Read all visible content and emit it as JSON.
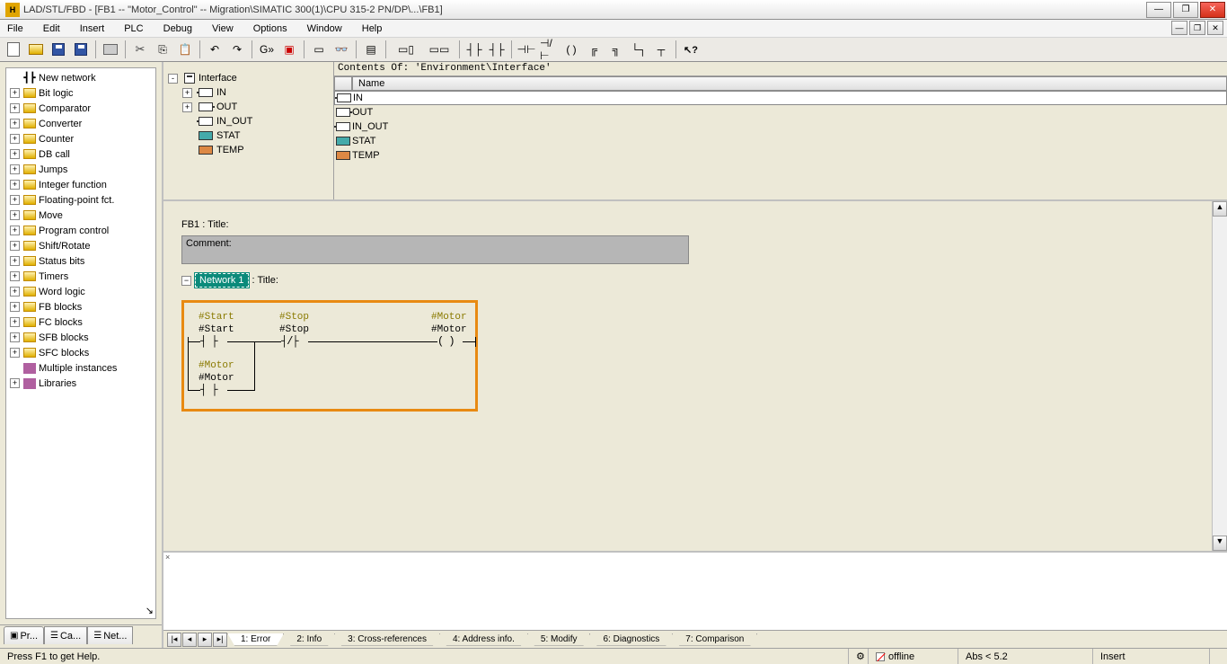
{
  "titlebar": {
    "text": "LAD/STL/FBD  - [FB1 -- \"Motor_Control\" -- Migration\\SIMATIC 300(1)\\CPU 315-2 PN/DP\\...\\FB1]"
  },
  "menu": {
    "items": [
      "File",
      "Edit",
      "Insert",
      "PLC",
      "Debug",
      "View",
      "Options",
      "Window",
      "Help"
    ]
  },
  "sidebar": {
    "items": [
      {
        "label": "New network",
        "expandable": false,
        "icon": "network"
      },
      {
        "label": "Bit logic",
        "expandable": true,
        "icon": "folder"
      },
      {
        "label": "Comparator",
        "expandable": true,
        "icon": "folder"
      },
      {
        "label": "Converter",
        "expandable": true,
        "icon": "folder"
      },
      {
        "label": "Counter",
        "expandable": true,
        "icon": "folder"
      },
      {
        "label": "DB call",
        "expandable": true,
        "icon": "folder"
      },
      {
        "label": "Jumps",
        "expandable": true,
        "icon": "folder"
      },
      {
        "label": "Integer function",
        "expandable": true,
        "icon": "folder"
      },
      {
        "label": "Floating-point fct.",
        "expandable": true,
        "icon": "folder"
      },
      {
        "label": "Move",
        "expandable": true,
        "icon": "folder"
      },
      {
        "label": "Program control",
        "expandable": true,
        "icon": "folder"
      },
      {
        "label": "Shift/Rotate",
        "expandable": true,
        "icon": "folder"
      },
      {
        "label": "Status bits",
        "expandable": true,
        "icon": "folder"
      },
      {
        "label": "Timers",
        "expandable": true,
        "icon": "folder"
      },
      {
        "label": "Word logic",
        "expandable": true,
        "icon": "folder"
      },
      {
        "label": "FB blocks",
        "expandable": true,
        "icon": "folder"
      },
      {
        "label": "FC blocks",
        "expandable": true,
        "icon": "folder"
      },
      {
        "label": "SFB blocks",
        "expandable": true,
        "icon": "folder"
      },
      {
        "label": "SFC blocks",
        "expandable": true,
        "icon": "folder"
      },
      {
        "label": "Multiple instances",
        "expandable": false,
        "icon": "books"
      },
      {
        "label": "Libraries",
        "expandable": true,
        "icon": "books"
      }
    ],
    "tabs": [
      "Pr...",
      "Ca...",
      "Net..."
    ]
  },
  "interface": {
    "contents_label": "Contents Of: 'Environment\\Interface'",
    "tree": [
      {
        "label": "Interface",
        "level": 0,
        "exp": "-",
        "icon": "intf"
      },
      {
        "label": "IN",
        "level": 1,
        "exp": "+",
        "icon": "in"
      },
      {
        "label": "OUT",
        "level": 1,
        "exp": "+",
        "icon": "out"
      },
      {
        "label": "IN_OUT",
        "level": 1,
        "exp": "",
        "icon": "inout"
      },
      {
        "label": "STAT",
        "level": 1,
        "exp": "",
        "icon": "stat"
      },
      {
        "label": "TEMP",
        "level": 1,
        "exp": "",
        "icon": "temp"
      }
    ],
    "columns": {
      "name": "Name"
    },
    "rows": [
      {
        "name": "IN",
        "icon": "in",
        "selected": true
      },
      {
        "name": "OUT",
        "icon": "out"
      },
      {
        "name": "IN_OUT",
        "icon": "inout"
      },
      {
        "name": "STAT",
        "icon": "stat"
      },
      {
        "name": "TEMP",
        "icon": "temp"
      }
    ]
  },
  "editor": {
    "fb_title": "FB1 : Title:",
    "comment_label": "Comment:",
    "network_label": "Network 1",
    "network_title_suffix": ": Title:",
    "symbols": {
      "start_tag": "#Start",
      "start_lbl": "#Start",
      "stop_tag": "#Stop",
      "stop_lbl": "#Stop",
      "motor_tag": "#Motor",
      "motor_lbl": "#Motor",
      "motor2_tag": "#Motor",
      "motor2_lbl": "#Motor"
    }
  },
  "bottom_tabs": [
    "1: Error",
    "2: Info",
    "3: Cross-references",
    "4: Address info.",
    "5: Modify",
    "6: Diagnostics",
    "7: Comparison"
  ],
  "status": {
    "help": "Press F1 to get Help.",
    "conn": "offline",
    "abs": "Abs < 5.2",
    "insert": "Insert"
  }
}
